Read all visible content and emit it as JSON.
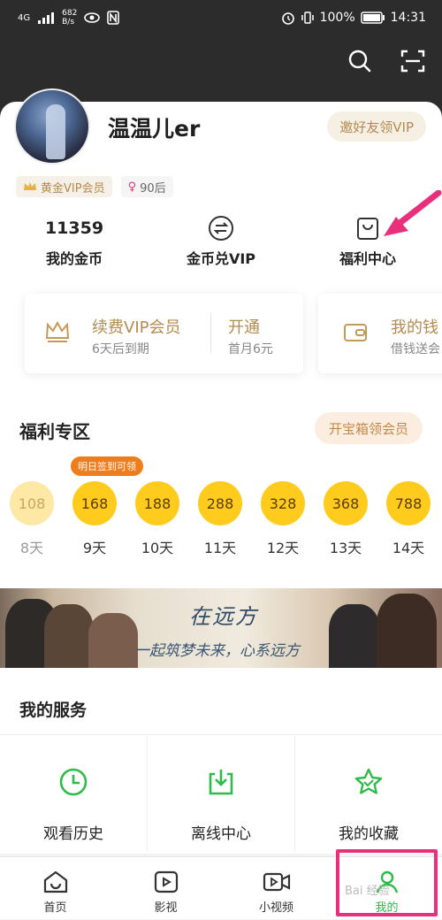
{
  "status_bar": {
    "network": "4G",
    "speed_top": "682",
    "speed_unit": "B/s",
    "battery": "100%",
    "time": "14:31"
  },
  "header": {
    "search_icon": "search-icon",
    "scan_icon": "scan-icon"
  },
  "profile": {
    "name": "温温儿er",
    "invite_label": "邀好友领VIP",
    "vip_badge": "黄金VIP会员",
    "gen_badge": "90后"
  },
  "stats": [
    {
      "value": "11359",
      "label": "我的金币"
    },
    {
      "icon": "exchange-icon",
      "label": "金币兑VIP"
    },
    {
      "icon": "gift-box-icon",
      "label": "福利中心"
    }
  ],
  "vip_card": {
    "title": "续费VIP会员",
    "subtitle": "6天后到期",
    "open_label": "开通",
    "open_sub": "首月6元"
  },
  "wallet_card": {
    "title": "我的钱",
    "subtitle": "借钱送会"
  },
  "welfare": {
    "title": "福利专区",
    "treasure_label": "开宝箱领会员",
    "tip": "明日签到可领",
    "coins": [
      {
        "value": "108",
        "day": "8天",
        "past": true
      },
      {
        "value": "168",
        "day": "9天",
        "past": false
      },
      {
        "value": "188",
        "day": "10天",
        "past": false
      },
      {
        "value": "288",
        "day": "11天",
        "past": false
      },
      {
        "value": "328",
        "day": "12天",
        "past": false
      },
      {
        "value": "368",
        "day": "13天",
        "past": false
      },
      {
        "value": "788",
        "day": "14天",
        "past": false
      }
    ]
  },
  "banner": {
    "title": "在远方",
    "subtitle": "一起筑梦未来，心系远方"
  },
  "services": {
    "title": "我的服务",
    "items": [
      {
        "label": "观看历史",
        "icon": "clock-icon"
      },
      {
        "label": "离线中心",
        "icon": "download-icon"
      },
      {
        "label": "我的收藏",
        "icon": "star-icon"
      }
    ]
  },
  "tabbar": {
    "items": [
      {
        "label": "首页",
        "icon": "home-icon"
      },
      {
        "label": "影视",
        "icon": "film-icon"
      },
      {
        "label": "小视频",
        "icon": "video-icon"
      },
      {
        "label": "我的",
        "icon": "user-icon",
        "active": true
      }
    ]
  },
  "watermark": "Bai 经验",
  "colors": {
    "accent_green": "#2dbb4a",
    "gold": "#b58a4e",
    "coin": "#ffcc1e",
    "highlight": "#e8307d"
  }
}
